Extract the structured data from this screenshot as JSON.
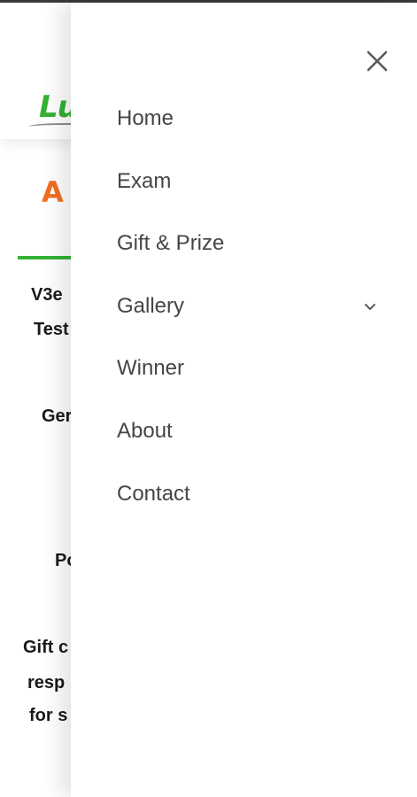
{
  "background": {
    "logo_text": "Lu",
    "icon_letter": "A",
    "lines": [
      "V3e",
      "Test",
      "Ger",
      "Po",
      "Gift c",
      "resp",
      "for s"
    ]
  },
  "drawer": {
    "menu": [
      {
        "label": "Home"
      },
      {
        "label": "Exam"
      },
      {
        "label": "Gift & Prize"
      },
      {
        "label": "Gallery",
        "has_submenu": true
      },
      {
        "label": "Winner"
      },
      {
        "label": "About"
      },
      {
        "label": "Contact"
      }
    ]
  },
  "colors": {
    "brand_green": "#34b233",
    "accent_orange": "#f07020",
    "menu_text": "#454545"
  },
  "icons": {
    "close": "close-icon",
    "submenu": "chevron-down-icon"
  }
}
